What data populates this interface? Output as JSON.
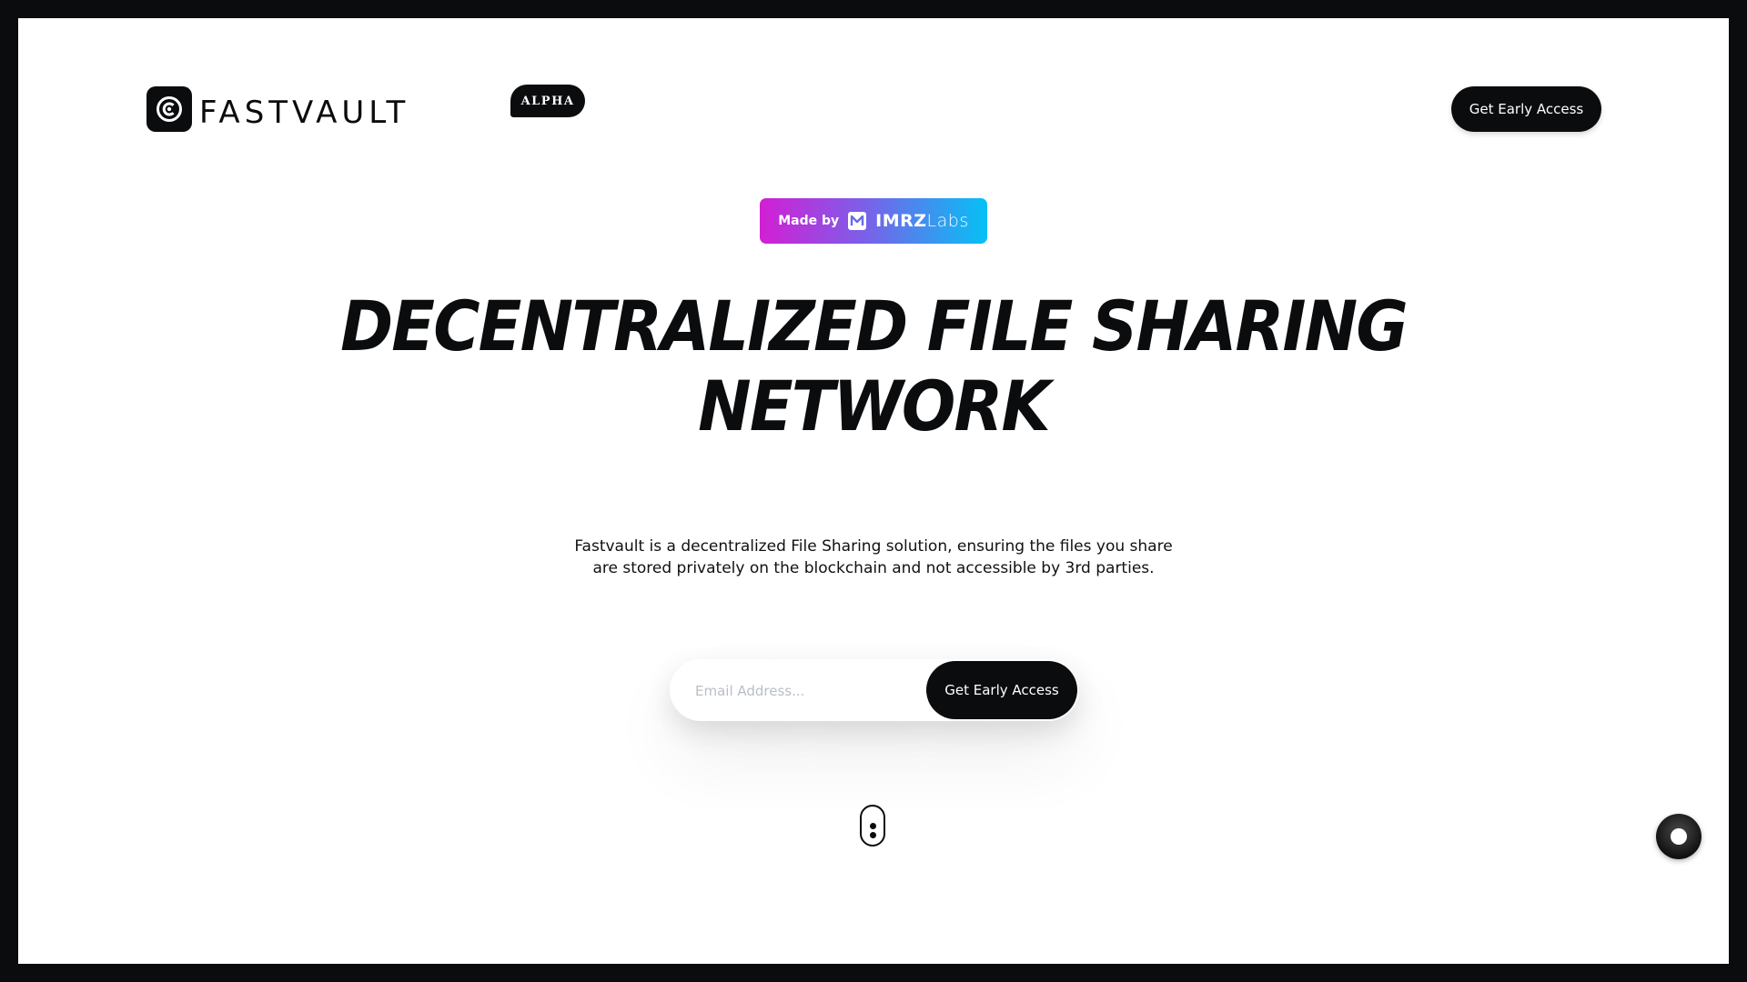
{
  "header": {
    "logo_text": "FASTVAULT",
    "badge": "ALPHA",
    "cta_label": "Get Early Access"
  },
  "made_by": {
    "prefix": "Made by",
    "brand_bold": "IMRZ",
    "brand_light": "Labs"
  },
  "hero": {
    "headline_line1": "Decentralized File Sharing",
    "headline_line2": "Network",
    "description_line1": "Fastvault is a decentralized File Sharing solution, ensuring the files you share",
    "description_line2": "are stored privately on the blockchain and not accessible by 3rd parties."
  },
  "signup": {
    "email_placeholder": "Email Address...",
    "email_value": "",
    "submit_label": "Get Early Access"
  },
  "icons": {
    "logo": "vault-logo-icon",
    "imrz": "imrz-logo-icon",
    "scroll": "scroll-mouse-icon",
    "float": "toggle-circle-icon"
  },
  "colors": {
    "primary": "#0b0c0e",
    "background": "#ffffff",
    "gradient_start": "#d21fd4",
    "gradient_end": "#05c1f5"
  }
}
